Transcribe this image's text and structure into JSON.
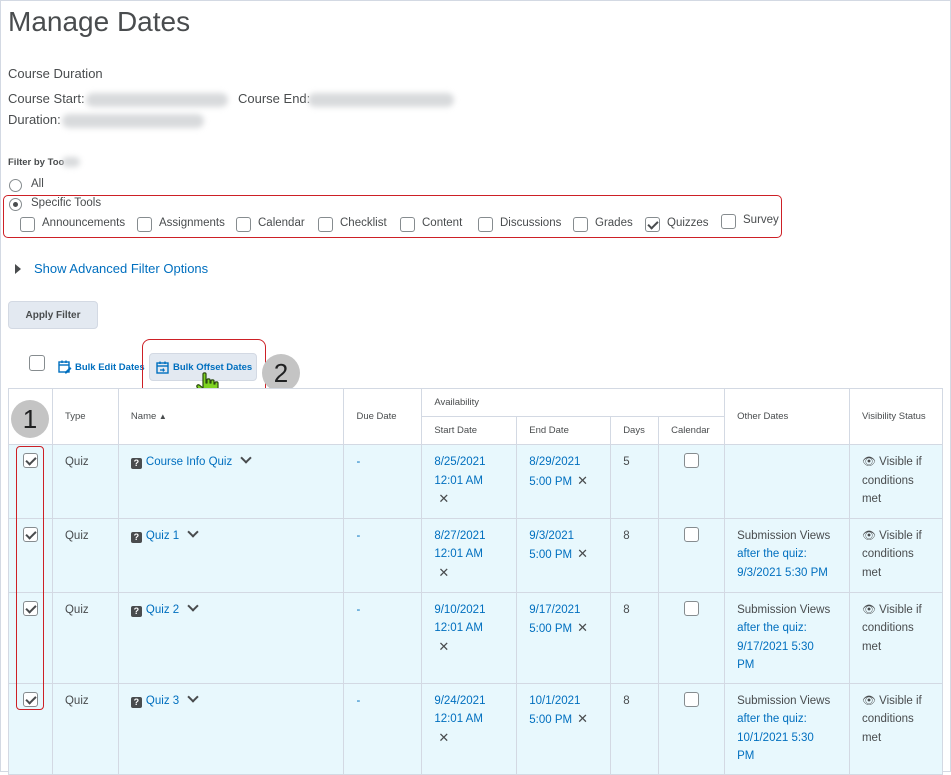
{
  "page": {
    "title": "Manage Dates"
  },
  "duration": {
    "heading": "Course Duration",
    "start_label": "Course Start:",
    "end_label": "Course End:",
    "duration_label": "Duration:"
  },
  "filter": {
    "label": "Filter by Too",
    "all_label": "All",
    "specific_label": "Specific Tools",
    "tools": [
      {
        "label": "Announcements",
        "checked": false
      },
      {
        "label": "Assignments",
        "checked": false
      },
      {
        "label": "Calendar",
        "checked": false
      },
      {
        "label": "Checklist",
        "checked": false
      },
      {
        "label": "Content",
        "checked": false
      },
      {
        "label": "Discussions",
        "checked": false
      },
      {
        "label": "Grades",
        "checked": false
      },
      {
        "label": "Quizzes",
        "checked": true
      },
      {
        "label": "Survey",
        "checked": false
      }
    ],
    "advanced_label": "Show Advanced Filter Options",
    "apply_label": "Apply Filter"
  },
  "toolbar": {
    "bulk_edit_label": "Bulk Edit Dates",
    "bulk_offset_label": "Bulk Offset Dates"
  },
  "markers": {
    "one": "1",
    "two": "2"
  },
  "table": {
    "headers": {
      "type": "Type",
      "name": "Name",
      "due": "Due Date",
      "availability": "Availability",
      "start": "Start Date",
      "end": "End Date",
      "days": "Days",
      "calendar": "Calendar",
      "other": "Other Dates",
      "visibility": "Visibility Status"
    },
    "rows": [
      {
        "type": "Quiz",
        "name": "Course Info Quiz",
        "due": "-",
        "start_date": "8/25/2021",
        "start_time": "12:01 AM",
        "end_date": "8/29/2021",
        "end_time": "5:00 PM",
        "days": "5",
        "other_label": "",
        "other_lines": [],
        "vis1": "Visible if",
        "vis2": "conditions",
        "vis3": "met"
      },
      {
        "type": "Quiz",
        "name": "Quiz 1",
        "due": "-",
        "start_date": "8/27/2021",
        "start_time": "12:01 AM",
        "end_date": "9/3/2021",
        "end_time": "5:00 PM",
        "days": "8",
        "other_label": "Submission Views",
        "other_lines": [
          "after the quiz:",
          "9/3/2021 5:30 PM"
        ],
        "vis1": "Visible if",
        "vis2": "conditions",
        "vis3": "met"
      },
      {
        "type": "Quiz",
        "name": "Quiz 2",
        "due": "-",
        "start_date": "9/10/2021",
        "start_time": "12:01 AM",
        "end_date": "9/17/2021",
        "end_time": "5:00 PM",
        "days": "8",
        "other_label": "Submission Views",
        "other_lines": [
          "after the quiz:",
          "9/17/2021 5:30",
          "PM"
        ],
        "vis1": "Visible if",
        "vis2": "conditions",
        "vis3": "met"
      },
      {
        "type": "Quiz",
        "name": "Quiz 3",
        "due": "-",
        "start_date": "9/24/2021",
        "start_time": "12:01 AM",
        "end_date": "10/1/2021",
        "end_time": "5:00 PM",
        "days": "8",
        "other_label": "Submission Views",
        "other_lines": [
          "after the quiz:",
          "10/1/2021 5:30",
          "PM"
        ],
        "vis1": "Visible if",
        "vis2": "conditions",
        "vis3": "met"
      }
    ]
  },
  "colors": {
    "link": "#006fbf",
    "row_bg": "#e8f8fd",
    "highlight": "#cd2026",
    "marker": "#c4c4c4"
  }
}
